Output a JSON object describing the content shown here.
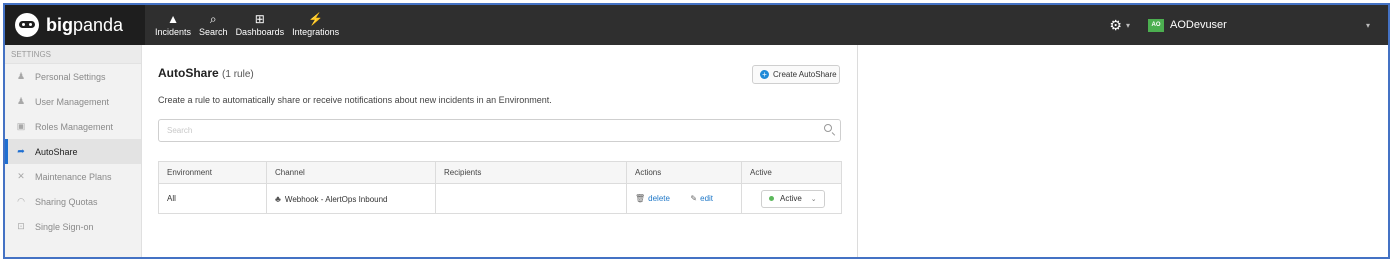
{
  "brand": {
    "name_bold": "big",
    "name_regular": "panda"
  },
  "nav": [
    {
      "label": "Incidents",
      "icon": "warning-icon"
    },
    {
      "label": "Search",
      "icon": "search-icon"
    },
    {
      "label": "Dashboards",
      "icon": "grid-icon"
    },
    {
      "label": "Integrations",
      "icon": "plug-icon"
    }
  ],
  "topbar": {
    "user_initials": "AO",
    "user_name": "AODevuser",
    "user_badge_color": "#4caf50"
  },
  "sidebar": {
    "heading": "SETTINGS",
    "items": [
      {
        "label": "Personal Settings",
        "icon": "user-icon"
      },
      {
        "label": "User Management",
        "icon": "users-icon"
      },
      {
        "label": "Roles Management",
        "icon": "lock-icon"
      },
      {
        "label": "AutoShare",
        "icon": "share-arrow-icon",
        "active": true
      },
      {
        "label": "Maintenance Plans",
        "icon": "tools-icon"
      },
      {
        "label": "Sharing Quotas",
        "icon": "gauge-icon"
      },
      {
        "label": "Single Sign-on",
        "icon": "sign-in-icon"
      }
    ]
  },
  "main": {
    "title": "AutoShare",
    "rule_count": "(1 rule)",
    "create_button": "Create AutoShare",
    "description": "Create a rule to automatically share or receive notifications about new incidents in an Environment.",
    "search_placeholder": "Search",
    "table": {
      "columns": [
        "Environment",
        "Channel",
        "Recipients",
        "Actions",
        "Active"
      ],
      "rows": [
        {
          "environment": "All",
          "channel": "Webhook - AlertOps Inbound",
          "recipients": "",
          "delete_label": "delete",
          "edit_label": "edit",
          "status": "Active",
          "status_color": "#5cb85c"
        }
      ]
    }
  },
  "colors": {
    "accent": "#1f6fd1",
    "topbar": "#2f2f2f",
    "link": "#1f78c8"
  }
}
